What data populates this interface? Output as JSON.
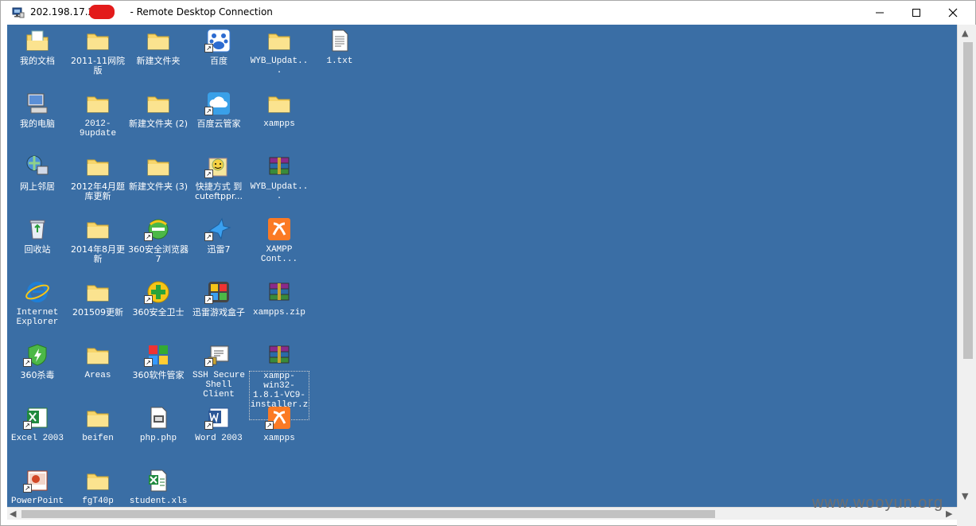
{
  "window": {
    "title_prefix": "202.198.17.226",
    "title_suffix": "- Remote Desktop Connection",
    "controls": {
      "minimize": "minimize",
      "maximize": "maximize",
      "close": "close"
    }
  },
  "colors": {
    "desktop": "#3a6ea5",
    "folder": "#f7d56b",
    "label": "#ffffff"
  },
  "desktop": {
    "icons": [
      {
        "label": "我的文档",
        "icon": "my-documents-icon",
        "shortcut": false
      },
      {
        "label": "我的电脑",
        "icon": "my-computer-icon",
        "shortcut": false
      },
      {
        "label": "网上邻居",
        "icon": "network-places-icon",
        "shortcut": false
      },
      {
        "label": "回收站",
        "icon": "recycle-bin-icon",
        "shortcut": false
      },
      {
        "label": "Internet Explorer",
        "icon": "internet-explorer-icon",
        "shortcut": false
      },
      {
        "label": "360杀毒",
        "icon": "360-antivirus-icon",
        "shortcut": true
      },
      {
        "label": "Excel 2003",
        "icon": "excel-icon",
        "shortcut": true
      },
      {
        "label": "PowerPoint",
        "icon": "powerpoint-icon",
        "shortcut": true
      },
      {
        "label": "2011-11网院版",
        "icon": "folder-icon",
        "shortcut": false
      },
      {
        "label": "2012-9update",
        "icon": "folder-icon",
        "shortcut": false
      },
      {
        "label": "2012年4月题库更新",
        "icon": "folder-icon",
        "shortcut": false
      },
      {
        "label": "2014年8月更新",
        "icon": "folder-icon",
        "shortcut": false
      },
      {
        "label": "201509更新",
        "icon": "folder-icon",
        "shortcut": false
      },
      {
        "label": "Areas",
        "icon": "folder-icon",
        "shortcut": false
      },
      {
        "label": "beifen",
        "icon": "folder-icon",
        "shortcut": false
      },
      {
        "label": "fgT40p",
        "icon": "folder-icon",
        "shortcut": false
      },
      {
        "label": "新建文件夹",
        "icon": "folder-icon",
        "shortcut": false
      },
      {
        "label": "新建文件夹 (2)",
        "icon": "folder-icon",
        "shortcut": false
      },
      {
        "label": "新建文件夹 (3)",
        "icon": "folder-icon",
        "shortcut": false
      },
      {
        "label": "360安全浏览器7",
        "icon": "360-browser-icon",
        "shortcut": true
      },
      {
        "label": "360安全卫士",
        "icon": "360-safeguard-icon",
        "shortcut": true
      },
      {
        "label": "360软件管家",
        "icon": "360-software-manager-icon",
        "shortcut": true
      },
      {
        "label": "php.php",
        "icon": "php-file-icon",
        "shortcut": false
      },
      {
        "label": "student.xls",
        "icon": "excel-file-icon",
        "shortcut": false
      },
      {
        "label": "百度",
        "icon": "baidu-icon",
        "shortcut": true
      },
      {
        "label": "百度云管家",
        "icon": "baidu-cloud-icon",
        "shortcut": true
      },
      {
        "label": "快捷方式 到 cuteftppr...",
        "icon": "cuteftp-icon",
        "shortcut": true
      },
      {
        "label": "迅雷7",
        "icon": "xunlei-icon",
        "shortcut": true
      },
      {
        "label": "迅雷游戏盒子",
        "icon": "game-box-icon",
        "shortcut": true
      },
      {
        "label": "SSH Secure Shell Client",
        "icon": "ssh-client-icon",
        "shortcut": true
      },
      {
        "label": "Word 2003",
        "icon": "word-icon",
        "shortcut": true
      },
      {
        "label": "WYB_Updat...",
        "icon": "folder-icon",
        "shortcut": false
      },
      {
        "label": "xampps",
        "icon": "folder-icon",
        "shortcut": false
      },
      {
        "label": "WYB_Updat...",
        "icon": "winrar-archive-icon",
        "shortcut": false
      },
      {
        "label": "XAMPP Cont...",
        "icon": "xampp-icon",
        "shortcut": false
      },
      {
        "label": "xampps.zip",
        "icon": "winrar-archive-icon",
        "shortcut": false
      },
      {
        "label": "xampp-win32-1.8.1-VC9-installer.zip",
        "icon": "winrar-archive-icon",
        "shortcut": false,
        "selected": true
      },
      {
        "label": "xampps",
        "icon": "xampp-icon",
        "shortcut": true
      },
      {
        "label": "1.txt",
        "icon": "text-file-icon",
        "shortcut": false
      }
    ]
  },
  "watermark": "www.wooyun.org"
}
